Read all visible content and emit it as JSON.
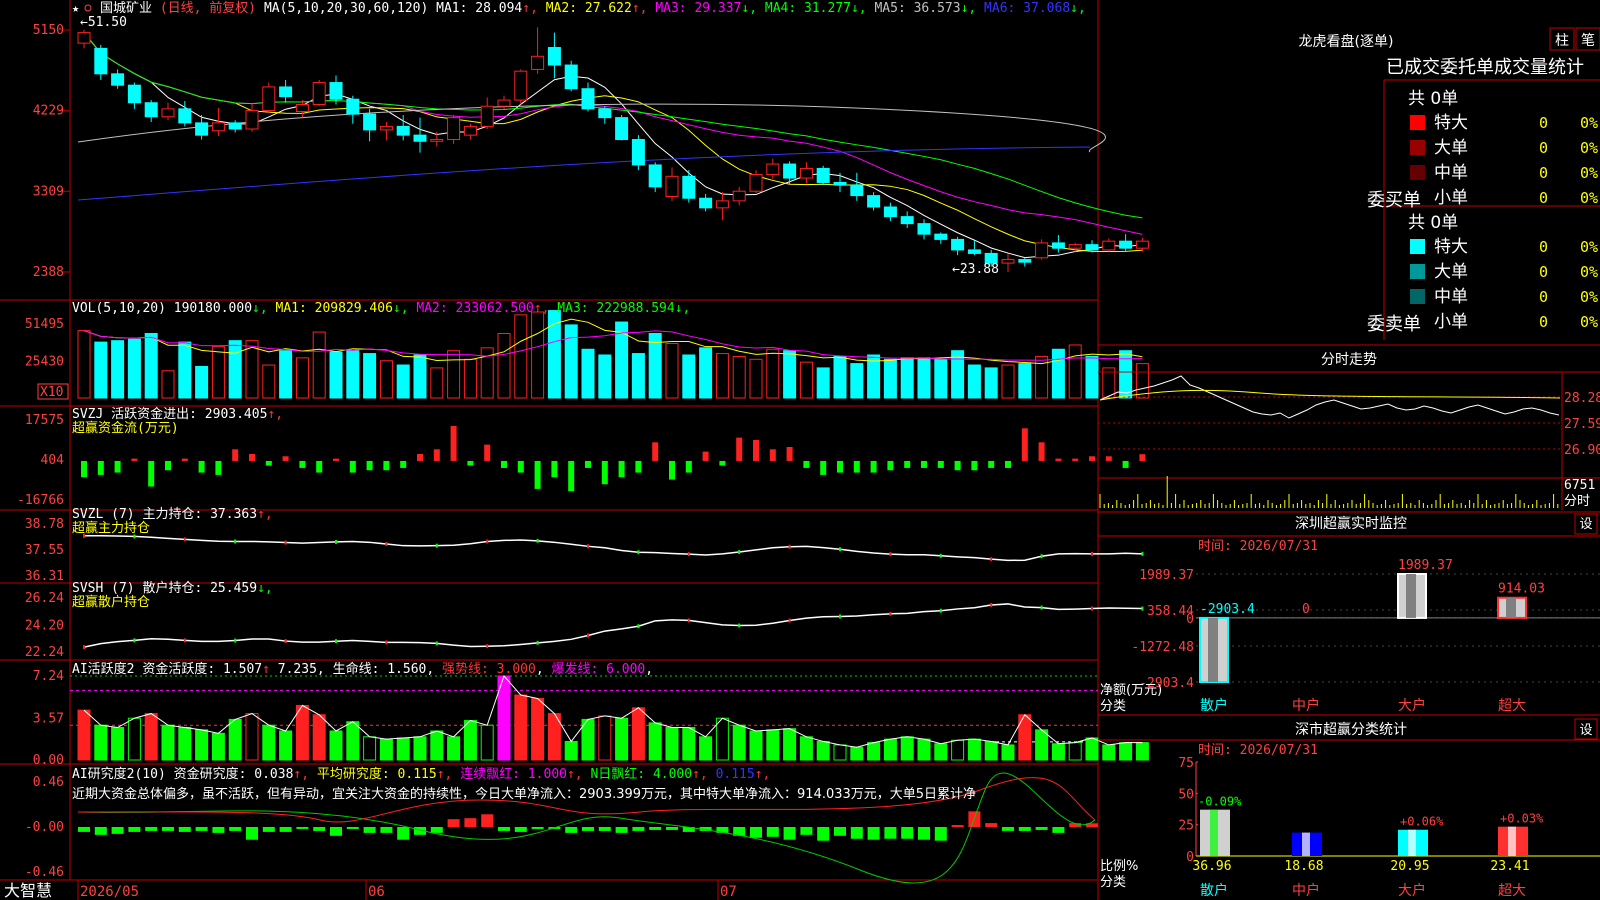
{
  "main": {
    "stock_name": "国城矿业",
    "period": "(日线, 前复权)",
    "ma_label": "MA(5,10,20,30,60,120)",
    "ma_values": [
      {
        "text": "MA1: 28.094",
        "arrow": "↑",
        "color": "#ffffff"
      },
      {
        "text": "MA2: 27.622",
        "arrow": "↑",
        "color": "#ffff00"
      },
      {
        "text": "MA3: 29.337",
        "arrow": "↓",
        "color": "#ff00ff"
      },
      {
        "text": "MA4: 31.277",
        "arrow": "↓",
        "color": "#00ff00"
      },
      {
        "text": "MA5: 36.573",
        "arrow": "↓",
        "color": "#c0c0c0"
      },
      {
        "text": "MA6: 37.068",
        "arrow": "↓",
        "color": "#3333ff"
      }
    ],
    "y_ticks": [
      "5150",
      "4229",
      "3309",
      "2388"
    ],
    "high_label": "←51.50",
    "low_label": "←23.88",
    "star_glyph": "★"
  },
  "vol": {
    "label": "VOL(5,10,20)",
    "value": "190180.000",
    "ma": [
      {
        "text": "MA1: 209829.406",
        "arrow": "↓",
        "color": "#ffff00"
      },
      {
        "text": "MA2: 233062.500",
        "arrow": "↑",
        "color": "#ff00ff"
      },
      {
        "text": "MA3: 222988.594",
        "arrow": "↓",
        "color": "#00ff00"
      }
    ],
    "y_ticks": [
      "51495",
      "25430"
    ],
    "unit": "X10"
  },
  "svzj": {
    "title": "SVZJ  活跃资金进出: 2903.405",
    "arrow": "↑",
    "sub": "超赢资金流(万元)",
    "y_ticks": [
      "17575",
      "404",
      "-16766"
    ]
  },
  "svzl": {
    "title": "SVZL (7) 主力持仓: 37.363",
    "arrow": "↑",
    "sub": "超赢主力持仓",
    "y_ticks": [
      "38.78",
      "37.55",
      "36.31"
    ]
  },
  "svsh": {
    "title": "SVSH (7) 散户持仓: 25.459",
    "arrow": "↓",
    "sub": "超赢散户持仓",
    "y_ticks": [
      "26.24",
      "24.20",
      "22.24"
    ]
  },
  "ai1": {
    "title": "AI活跃度2",
    "items": [
      {
        "text": "资金活跃度: 1.507",
        "arrow": "↑",
        "color": "#ffffff"
      },
      {
        "text": "7.235",
        "arrow": ",",
        "color": "#ffffff"
      },
      {
        "text": "生命线: 1.560",
        "arrow": ",",
        "color": "#ffffff"
      },
      {
        "text": "强势线: 3.000",
        "arrow": ",",
        "color": "#ff3333"
      },
      {
        "text": "爆发线: 6.000",
        "arrow": ",",
        "color": "#ff00ff"
      }
    ],
    "y_ticks": [
      "7.24",
      "3.57",
      "0.00"
    ]
  },
  "ai2": {
    "title": "AI研究度2(10)",
    "items": [
      {
        "text": "资金研究度: 0.038",
        "arrow": "↑",
        "color": "#ffffff"
      },
      {
        "text": "平均研究度: 0.115",
        "arrow": "↑",
        "color": "#ffff00"
      },
      {
        "text": "连续飘红: 1.000",
        "arrow": "↑",
        "color": "#ff00ff"
      },
      {
        "text": "N日飘红: 4.000",
        "arrow": "↑",
        "color": "#00ff00"
      },
      {
        "text": "0.115",
        "arrow": "↑",
        "color": "#3333ff"
      }
    ],
    "comment": "近期大资金总体偏多，虽不活跃，但有异动，宜关注大资金的持续性，今日大单净流入：2903.399万元，其中特大单净流入：914.033万元，大单5日累计净",
    "y_ticks": [
      "0.46",
      "-0.00",
      "-0.46"
    ]
  },
  "x_axis": {
    "brand": "大智慧",
    "labels": [
      "2026/05",
      "06",
      "07"
    ]
  },
  "lhb": {
    "title": "龙虎看盘(逐单)",
    "tabs": [
      "柱",
      "笔"
    ],
    "subtitle": "已成交委托单成交量统计",
    "buy": {
      "side": "委买单",
      "total": "共 0单",
      "rows": [
        {
          "name": "特大",
          "count": "0",
          "pct": "0%",
          "color": "#ff0000"
        },
        {
          "name": "大单",
          "count": "0",
          "pct": "0%",
          "color": "#990000"
        },
        {
          "name": "中单",
          "count": "0",
          "pct": "0%",
          "color": "#660000"
        },
        {
          "name": "小单",
          "count": "0",
          "pct": "0%",
          "color": ""
        }
      ]
    },
    "sell": {
      "side": "委卖单",
      "total": "共 0单",
      "rows": [
        {
          "name": "特大",
          "count": "0",
          "pct": "0%",
          "color": "#00ffff"
        },
        {
          "name": "大单",
          "count": "0",
          "pct": "0%",
          "color": "#009999"
        },
        {
          "name": "中单",
          "count": "0",
          "pct": "0%",
          "color": "#006666"
        },
        {
          "name": "小单",
          "count": "0",
          "pct": "0%",
          "color": ""
        }
      ]
    }
  },
  "intraday": {
    "title": "分时走势",
    "y_ticks": [
      "28.28",
      "27.59",
      "26.90"
    ],
    "vol_tick": "6751",
    "vol_unit": "分时"
  },
  "sz_monitor": {
    "title": "深圳超赢实时监控",
    "set_label": "设",
    "time": "时间: 2026/07/31",
    "y_ticks": [
      "1989.37",
      "358.44",
      "0",
      "-1272.48",
      "-2903.4"
    ],
    "left_labels": [
      "净额(万元)",
      "分类"
    ],
    "categories": [
      "散户",
      "中户",
      "大户",
      "超大"
    ]
  },
  "sz_class": {
    "title": "深市超赢分类统计",
    "set_label": "设",
    "time": "时间: 2026/07/31",
    "y_ticks": [
      "75",
      "50",
      "25",
      "0"
    ],
    "left_labels": [
      "比例%",
      "分类"
    ],
    "categories": [
      "散户",
      "中户",
      "大户",
      "超大"
    ]
  },
  "chart_data": [
    {
      "type": "candlestick",
      "title": "国城矿业 (日线, 前复权)",
      "ylim": [
        23.88,
        51.5
      ],
      "y_ticks": [
        51.5,
        42.29,
        33.09,
        23.88
      ],
      "annotations": {
        "high": 51.5,
        "low": 23.88
      },
      "candles": [
        [
          50.0,
          51.5,
          49.4,
          51.2
        ],
        [
          49.4,
          49.8,
          45.8,
          46.5
        ],
        [
          46.5,
          47.0,
          44.8,
          45.2
        ],
        [
          45.2,
          45.5,
          42.5,
          43.2
        ],
        [
          43.2,
          43.5,
          41.0,
          41.6
        ],
        [
          41.6,
          43.2,
          41.2,
          42.5
        ],
        [
          42.5,
          43.4,
          40.5,
          40.9
        ],
        [
          40.9,
          41.8,
          39.0,
          39.5
        ],
        [
          40.0,
          42.6,
          39.4,
          40.9
        ],
        [
          40.9,
          41.2,
          39.8,
          40.2
        ],
        [
          40.2,
          43.2,
          39.9,
          42.3
        ],
        [
          42.3,
          45.5,
          42.0,
          45.0
        ],
        [
          45.0,
          45.8,
          43.2,
          43.9
        ],
        [
          42.2,
          43.5,
          41.5,
          43.0
        ],
        [
          43.0,
          45.8,
          42.8,
          45.5
        ],
        [
          45.5,
          46.3,
          43.0,
          43.6
        ],
        [
          43.6,
          44.0,
          40.8,
          41.9
        ],
        [
          41.9,
          42.5,
          38.8,
          40.1
        ],
        [
          40.1,
          41.0,
          38.9,
          40.5
        ],
        [
          40.5,
          41.8,
          38.9,
          39.5
        ],
        [
          39.5,
          41.5,
          37.5,
          38.8
        ],
        [
          38.8,
          39.9,
          38.2,
          39.0
        ],
        [
          39.0,
          41.8,
          38.5,
          41.5
        ],
        [
          39.5,
          40.8,
          39.0,
          40.5
        ],
        [
          40.5,
          43.8,
          40.2,
          42.8
        ],
        [
          42.8,
          44.0,
          42.5,
          43.5
        ],
        [
          43.5,
          47.0,
          43.0,
          46.8
        ],
        [
          47.0,
          51.8,
          46.5,
          48.5
        ],
        [
          49.5,
          51.2,
          46.0,
          47.5
        ],
        [
          47.5,
          48.0,
          44.5,
          44.8
        ],
        [
          44.8,
          45.5,
          42.2,
          42.5
        ],
        [
          42.5,
          42.8,
          40.8,
          41.5
        ],
        [
          41.5,
          41.8,
          38.9,
          39.0
        ],
        [
          39.0,
          39.5,
          35.5,
          36.1
        ],
        [
          36.1,
          36.4,
          33.0,
          33.6
        ],
        [
          32.5,
          35.8,
          32.0,
          34.8
        ],
        [
          34.8,
          35.5,
          31.8,
          32.3
        ],
        [
          32.3,
          32.8,
          30.8,
          31.2
        ],
        [
          31.2,
          33.0,
          29.8,
          32.0
        ],
        [
          32.0,
          33.6,
          31.5,
          33.1
        ],
        [
          33.1,
          35.5,
          32.9,
          35.0
        ],
        [
          35.0,
          36.8,
          34.5,
          36.2
        ],
        [
          36.2,
          36.5,
          33.9,
          34.6
        ],
        [
          34.6,
          36.4,
          34.0,
          35.7
        ],
        [
          35.7,
          36.0,
          33.8,
          34.1
        ],
        [
          34.1,
          35.2,
          33.0,
          33.8
        ],
        [
          33.8,
          35.2,
          32.0,
          32.6
        ],
        [
          32.6,
          33.0,
          30.9,
          31.3
        ],
        [
          31.3,
          31.8,
          29.7,
          30.2
        ],
        [
          30.2,
          30.8,
          28.9,
          29.4
        ],
        [
          29.4,
          29.9,
          27.6,
          28.2
        ],
        [
          28.2,
          28.4,
          27.1,
          27.6
        ],
        [
          27.6,
          27.9,
          25.8,
          26.4
        ],
        [
          26.4,
          27.5,
          25.8,
          26.0
        ],
        [
          26.0,
          26.4,
          24.5,
          24.9
        ],
        [
          24.9,
          26.0,
          23.88,
          25.3
        ],
        [
          25.3,
          25.5,
          24.5,
          25.0
        ],
        [
          25.5,
          27.6,
          25.3,
          27.2
        ],
        [
          27.2,
          28.1,
          26.1,
          26.6
        ],
        [
          26.6,
          27.2,
          26.2,
          27.0
        ],
        [
          27.0,
          27.5,
          26.1,
          26.4
        ],
        [
          26.4,
          27.7,
          26.2,
          27.4
        ],
        [
          27.4,
          28.2,
          26.3,
          26.6
        ],
        [
          26.6,
          27.8,
          26.2,
          27.4
        ]
      ],
      "ma": {
        "MA1": 28.094,
        "MA2": 27.622,
        "MA3": 29.337,
        "MA4": 31.277,
        "MA5": 36.573,
        "MA6": 37.068
      }
    },
    {
      "type": "bar",
      "title": "VOL(5,10,20)",
      "ylim": [
        0,
        60000
      ],
      "y_ticks": [
        51495,
        25430
      ],
      "unit": "X10",
      "values": [
        47000,
        39000,
        40000,
        41000,
        45000,
        19000,
        39000,
        22000,
        36000,
        40000,
        40000,
        23000,
        33000,
        28000,
        46000,
        32000,
        33000,
        31000,
        26000,
        23000,
        30000,
        21000,
        33000,
        27000,
        35000,
        45000,
        58000,
        60000,
        61000,
        51000,
        34000,
        30000,
        53000,
        31000,
        45000,
        38000,
        30000,
        35000,
        31000,
        29000,
        27000,
        34000,
        33000,
        25000,
        21000,
        29000,
        24000,
        30000,
        27000,
        28000,
        28000,
        27000,
        33000,
        23000,
        21000,
        23000,
        24000,
        29000,
        34000,
        37000,
        29000,
        21000,
        33000,
        24000
      ],
      "ma": {
        "MA1": 209829.406,
        "MA2": 233062.5,
        "MA3": 222988.594
      }
    },
    {
      "type": "bar",
      "title": "SVZJ 活跃资金进出",
      "ylim": [
        -16766,
        17575
      ],
      "y_ticks": [
        17575,
        404,
        -16766
      ],
      "values": [
        -7000,
        -6000,
        -5000,
        1000,
        -11000,
        -4000,
        1000,
        -5000,
        -6000,
        5000,
        3000,
        -2000,
        2000,
        -3000,
        -5000,
        1000,
        -5000,
        -4000,
        -4000,
        -3000,
        3000,
        5000,
        15000,
        -2000,
        7000,
        -3000,
        -5000,
        -12000,
        -7000,
        -13000,
        -3000,
        -10000,
        -7000,
        -5000,
        8000,
        -8000,
        -5000,
        4000,
        -2000,
        10000,
        9000,
        5000,
        6000,
        -3000,
        -6000,
        -5000,
        -5000,
        -5000,
        -4000,
        -3000,
        -3000,
        -3000,
        -4000,
        -4000,
        -3000,
        -3000,
        14000,
        8000,
        1000,
        1000,
        2000,
        2000,
        -3000,
        2900
      ],
      "current": 2903.405
    },
    {
      "type": "line",
      "title": "SVZL (7) 主力持仓",
      "ylim": [
        36.31,
        38.78
      ],
      "y_ticks": [
        38.78,
        37.55,
        36.31
      ],
      "values": [
        38.22,
        38.22,
        38.21,
        38.19,
        38.15,
        38.1,
        38.05,
        38.0,
        37.96,
        37.95,
        37.95,
        37.93,
        37.9,
        37.87,
        37.9,
        37.93,
        37.95,
        37.91,
        37.83,
        37.75,
        37.74,
        37.75,
        37.77,
        37.84,
        37.95,
        38.0,
        38.02,
        37.98,
        37.91,
        37.82,
        37.72,
        37.65,
        37.52,
        37.44,
        37.42,
        37.38,
        37.35,
        37.31,
        37.36,
        37.45,
        37.55,
        37.65,
        37.7,
        37.72,
        37.66,
        37.58,
        37.48,
        37.4,
        37.35,
        37.32,
        37.32,
        37.27,
        37.22,
        37.18,
        37.11,
        37.05,
        37.06,
        37.25,
        37.36,
        37.37,
        37.36,
        37.36,
        37.39,
        37.363
      ]
    },
    {
      "type": "line",
      "title": "SVSH (7) 散户持仓",
      "ylim": [
        22.24,
        26.24
      ],
      "y_ticks": [
        26.24,
        24.2,
        22.24
      ],
      "values": [
        22.6,
        22.86,
        23.01,
        23.1,
        23.22,
        23.18,
        23.1,
        23.03,
        23.03,
        23.09,
        23.2,
        23.2,
        23.05,
        22.97,
        22.97,
        23.04,
        23.09,
        23.03,
        22.95,
        22.95,
        22.93,
        22.88,
        22.75,
        22.65,
        22.67,
        22.7,
        22.8,
        22.92,
        23.03,
        23.18,
        23.46,
        23.79,
        23.95,
        24.15,
        24.55,
        24.62,
        24.58,
        24.42,
        24.25,
        24.2,
        24.22,
        24.37,
        24.57,
        24.75,
        24.85,
        24.87,
        24.91,
        25.0,
        25.07,
        25.1,
        25.23,
        25.3,
        25.43,
        25.52,
        25.72,
        25.8,
        25.57,
        25.53,
        25.4,
        25.42,
        25.46,
        25.5,
        25.48,
        25.459
      ]
    },
    {
      "type": "bar",
      "title": "AI活跃度2",
      "ylim": [
        0,
        7.24
      ],
      "y_ticks": [
        7.24,
        3.57,
        0.0
      ],
      "reference_lines": {
        "强势线": 3.0,
        "爆发线": 6.0
      },
      "values": [
        4.3,
        3.0,
        2.8,
        3.6,
        4.0,
        3.0,
        2.8,
        2.6,
        2.3,
        3.5,
        4.0,
        3.0,
        2.5,
        4.7,
        3.9,
        2.5,
        3.3,
        2.0,
        1.8,
        1.9,
        2.0,
        2.5,
        2.0,
        3.4,
        3.0,
        7.24,
        5.6,
        5.3,
        4.0,
        1.6,
        3.5,
        3.8,
        3.6,
        4.5,
        3.2,
        2.8,
        2.8,
        2.0,
        3.6,
        3.0,
        2.5,
        2.6,
        2.7,
        2.0,
        1.6,
        1.3,
        1.1,
        1.5,
        1.8,
        2.0,
        1.8,
        1.4,
        1.7,
        1.8,
        1.6,
        1.3,
        3.9,
        2.6,
        1.4,
        1.5,
        1.9,
        1.3,
        1.5,
        1.5
      ],
      "current": {
        "资金活跃度": 1.507,
        "生命线": 1.56
      }
    },
    {
      "type": "bar",
      "title": "AI研究度2(10)",
      "ylim": [
        -0.46,
        0.46
      ],
      "y_ticks": [
        0.46,
        -0.0,
        -0.46
      ],
      "values": [
        -0.05,
        -0.08,
        -0.07,
        -0.05,
        -0.04,
        -0.04,
        -0.05,
        -0.04,
        -0.06,
        -0.04,
        -0.13,
        -0.05,
        -0.05,
        -0.02,
        -0.04,
        -0.09,
        -0.02,
        -0.06,
        -0.06,
        -0.13,
        -0.08,
        -0.06,
        0.08,
        0.09,
        0.13,
        -0.04,
        -0.05,
        -0.02,
        -0.02,
        -0.06,
        -0.04,
        -0.04,
        -0.06,
        -0.04,
        -0.03,
        -0.03,
        -0.05,
        -0.04,
        -0.06,
        -0.09,
        -0.11,
        -0.1,
        -0.13,
        -0.08,
        -0.14,
        -0.09,
        -0.12,
        -0.13,
        -0.12,
        -0.12,
        -0.13,
        -0.14,
        0.02,
        0.16,
        0.04,
        -0.04,
        -0.04,
        -0.03,
        -0.06,
        0.04,
        0.038
      ],
      "current": {
        "资金研究度": 0.038,
        "平均研究度": 0.115
      }
    },
    {
      "type": "bar",
      "title": "深圳超赢实时监控",
      "categories": [
        "散户",
        "中户",
        "大户",
        "超大"
      ],
      "values": [
        -2903.4,
        0,
        1989.37,
        914.03
      ],
      "data_labels": [
        "-2903.4",
        "0",
        "1989.37",
        "914.03"
      ],
      "ylim": [
        -2903.4,
        1989.37
      ]
    },
    {
      "type": "bar",
      "title": "深市超赢分类统计",
      "categories": [
        "散户",
        "中户",
        "大户",
        "超大"
      ],
      "values": [
        36.96,
        18.68,
        20.95,
        23.41
      ],
      "changes": [
        "-0.09%",
        "",
        "+0.06%",
        "+0.03%"
      ],
      "ylim": [
        0,
        75
      ]
    }
  ]
}
